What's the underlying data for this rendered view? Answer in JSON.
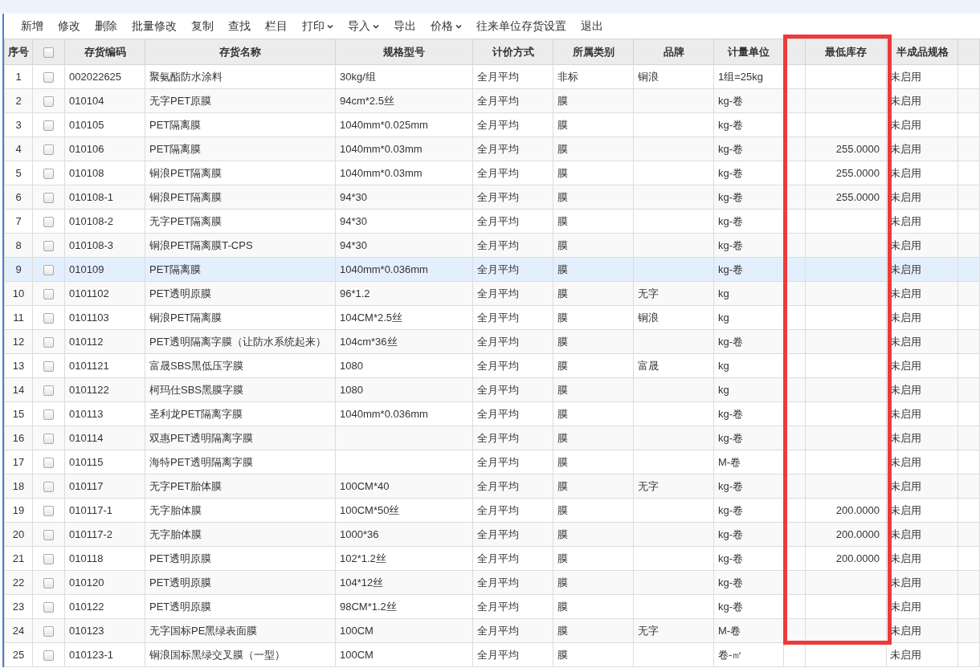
{
  "toolbar": [
    {
      "label": "新增",
      "dropdown": false
    },
    {
      "label": "修改",
      "dropdown": false
    },
    {
      "label": "删除",
      "dropdown": false
    },
    {
      "label": "批量修改",
      "dropdown": false
    },
    {
      "label": "复制",
      "dropdown": false
    },
    {
      "label": "查找",
      "dropdown": false
    },
    {
      "label": "栏目",
      "dropdown": false
    },
    {
      "label": "打印",
      "dropdown": true
    },
    {
      "label": "导入",
      "dropdown": true
    },
    {
      "label": "导出",
      "dropdown": false
    },
    {
      "label": "价格",
      "dropdown": true
    },
    {
      "label": "往来单位存货设置",
      "dropdown": false
    },
    {
      "label": "退出",
      "dropdown": false
    }
  ],
  "table": {
    "select_all_checked": false,
    "columns": {
      "index": "序号",
      "code": "存货编码",
      "name": "存货名称",
      "spec": "规格型号",
      "pricing": "计价方式",
      "category": "所属类别",
      "brand": "品牌",
      "unit": "计量单位",
      "min_stock": "最低库存",
      "semi": "半成品规格"
    },
    "rows": [
      {
        "index": "1",
        "checked": false,
        "selected": false,
        "code": "002022625",
        "name": "聚氨酯防水涂料",
        "spec": "30kg/组",
        "pricing": "全月平均",
        "category": "非标",
        "brand": "铜浪",
        "unit": "1组=25kg",
        "min_stock": "",
        "semi": "未启用"
      },
      {
        "index": "2",
        "checked": false,
        "selected": false,
        "code": "010104",
        "name": "无字PET原膜",
        "spec": "94cm*2.5丝",
        "pricing": "全月平均",
        "category": "膜",
        "brand": "",
        "unit": "kg-卷",
        "min_stock": "",
        "semi": "未启用"
      },
      {
        "index": "3",
        "checked": false,
        "selected": false,
        "code": "010105",
        "name": "PET隔离膜",
        "spec": "1040mm*0.025mm",
        "pricing": "全月平均",
        "category": "膜",
        "brand": "",
        "unit": "kg-卷",
        "min_stock": "",
        "semi": "未启用"
      },
      {
        "index": "4",
        "checked": false,
        "selected": false,
        "code": "010106",
        "name": "PET隔离膜",
        "spec": "1040mm*0.03mm",
        "pricing": "全月平均",
        "category": "膜",
        "brand": "",
        "unit": "kg-卷",
        "min_stock": "255.0000",
        "semi": "未启用"
      },
      {
        "index": "5",
        "checked": false,
        "selected": false,
        "code": "010108",
        "name": "铜浪PET隔离膜",
        "spec": "1040mm*0.03mm",
        "pricing": "全月平均",
        "category": "膜",
        "brand": "",
        "unit": "kg-卷",
        "min_stock": "255.0000",
        "semi": "未启用"
      },
      {
        "index": "6",
        "checked": false,
        "selected": false,
        "code": "010108-1",
        "name": "铜浪PET隔离膜",
        "spec": "94*30",
        "pricing": "全月平均",
        "category": "膜",
        "brand": "",
        "unit": "kg-卷",
        "min_stock": "255.0000",
        "semi": "未启用"
      },
      {
        "index": "7",
        "checked": false,
        "selected": false,
        "code": "010108-2",
        "name": "无字PET隔离膜",
        "spec": "94*30",
        "pricing": "全月平均",
        "category": "膜",
        "brand": "",
        "unit": "kg-卷",
        "min_stock": "",
        "semi": "未启用"
      },
      {
        "index": "8",
        "checked": false,
        "selected": false,
        "code": "010108-3",
        "name": "铜浪PET隔离膜T-CPS",
        "spec": "94*30",
        "pricing": "全月平均",
        "category": "膜",
        "brand": "",
        "unit": "kg-卷",
        "min_stock": "",
        "semi": "未启用"
      },
      {
        "index": "9",
        "checked": false,
        "selected": true,
        "code": "010109",
        "name": "PET隔离膜",
        "spec": "1040mm*0.036mm",
        "pricing": "全月平均",
        "category": "膜",
        "brand": "",
        "unit": "kg-卷",
        "min_stock": "",
        "semi": "未启用"
      },
      {
        "index": "10",
        "checked": false,
        "selected": false,
        "code": "0101102",
        "name": "PET透明原膜",
        "spec": "96*1.2",
        "pricing": "全月平均",
        "category": "膜",
        "brand": "无字",
        "unit": "kg",
        "min_stock": "",
        "semi": "未启用"
      },
      {
        "index": "11",
        "checked": false,
        "selected": false,
        "code": "0101103",
        "name": "铜浪PET隔离膜",
        "spec": "104CM*2.5丝",
        "pricing": "全月平均",
        "category": "膜",
        "brand": "铜浪",
        "unit": "kg",
        "min_stock": "",
        "semi": "未启用"
      },
      {
        "index": "12",
        "checked": false,
        "selected": false,
        "code": "010112",
        "name": "PET透明隔离字膜（让防水系统起来）",
        "spec": "104cm*36丝",
        "pricing": "全月平均",
        "category": "膜",
        "brand": "",
        "unit": "kg-卷",
        "min_stock": "",
        "semi": "未启用"
      },
      {
        "index": "13",
        "checked": false,
        "selected": false,
        "code": "0101121",
        "name": "富晟SBS黑低压字膜",
        "spec": "1080",
        "pricing": "全月平均",
        "category": "膜",
        "brand": "富晟",
        "unit": "kg",
        "min_stock": "",
        "semi": "未启用"
      },
      {
        "index": "14",
        "checked": false,
        "selected": false,
        "code": "0101122",
        "name": "柯玛仕SBS黑膜字膜",
        "spec": "1080",
        "pricing": "全月平均",
        "category": "膜",
        "brand": "",
        "unit": "kg",
        "min_stock": "",
        "semi": "未启用"
      },
      {
        "index": "15",
        "checked": false,
        "selected": false,
        "code": "010113",
        "name": "圣利龙PET隔离字膜",
        "spec": "1040mm*0.036mm",
        "pricing": "全月平均",
        "category": "膜",
        "brand": "",
        "unit": "kg-卷",
        "min_stock": "",
        "semi": "未启用"
      },
      {
        "index": "16",
        "checked": false,
        "selected": false,
        "code": "010114",
        "name": "双惠PET透明隔离字膜",
        "spec": "",
        "pricing": "全月平均",
        "category": "膜",
        "brand": "",
        "unit": "kg-卷",
        "min_stock": "",
        "semi": "未启用"
      },
      {
        "index": "17",
        "checked": false,
        "selected": false,
        "code": "010115",
        "name": "海特PET透明隔离字膜",
        "spec": "",
        "pricing": "全月平均",
        "category": "膜",
        "brand": "",
        "unit": "M-卷",
        "min_stock": "",
        "semi": "未启用"
      },
      {
        "index": "18",
        "checked": false,
        "selected": false,
        "code": "010117",
        "name": "无字PET胎体膜",
        "spec": "100CM*40",
        "pricing": "全月平均",
        "category": "膜",
        "brand": "无字",
        "unit": "kg-卷",
        "min_stock": "",
        "semi": "未启用"
      },
      {
        "index": "19",
        "checked": false,
        "selected": false,
        "code": "010117-1",
        "name": "无字胎体膜",
        "spec": "100CM*50丝",
        "pricing": "全月平均",
        "category": "膜",
        "brand": "",
        "unit": "kg-卷",
        "min_stock": "200.0000",
        "semi": "未启用"
      },
      {
        "index": "20",
        "checked": false,
        "selected": false,
        "code": "010117-2",
        "name": "无字胎体膜",
        "spec": "1000*36",
        "pricing": "全月平均",
        "category": "膜",
        "brand": "",
        "unit": "kg-卷",
        "min_stock": "200.0000",
        "semi": "未启用"
      },
      {
        "index": "21",
        "checked": false,
        "selected": false,
        "code": "010118",
        "name": "PET透明原膜",
        "spec": "102*1.2丝",
        "pricing": "全月平均",
        "category": "膜",
        "brand": "",
        "unit": "kg-卷",
        "min_stock": "200.0000",
        "semi": "未启用"
      },
      {
        "index": "22",
        "checked": false,
        "selected": false,
        "code": "010120",
        "name": "PET透明原膜",
        "spec": "104*12丝",
        "pricing": "全月平均",
        "category": "膜",
        "brand": "",
        "unit": "kg-卷",
        "min_stock": "",
        "semi": "未启用"
      },
      {
        "index": "23",
        "checked": false,
        "selected": false,
        "code": "010122",
        "name": "PET透明原膜",
        "spec": "98CM*1.2丝",
        "pricing": "全月平均",
        "category": "膜",
        "brand": "",
        "unit": "kg-卷",
        "min_stock": "",
        "semi": "未启用"
      },
      {
        "index": "24",
        "checked": false,
        "selected": false,
        "code": "010123",
        "name": "无字国标PE黑绿表面膜",
        "spec": "100CM",
        "pricing": "全月平均",
        "category": "膜",
        "brand": "无字",
        "unit": "M-卷",
        "min_stock": "",
        "semi": "未启用"
      },
      {
        "index": "25",
        "checked": false,
        "selected": false,
        "code": "010123-1",
        "name": "铜浪国标黑绿交叉膜（一型）",
        "spec": "100CM",
        "pricing": "全月平均",
        "category": "膜",
        "brand": "",
        "unit": "卷-㎡",
        "min_stock": "",
        "semi": "未启用"
      }
    ]
  }
}
